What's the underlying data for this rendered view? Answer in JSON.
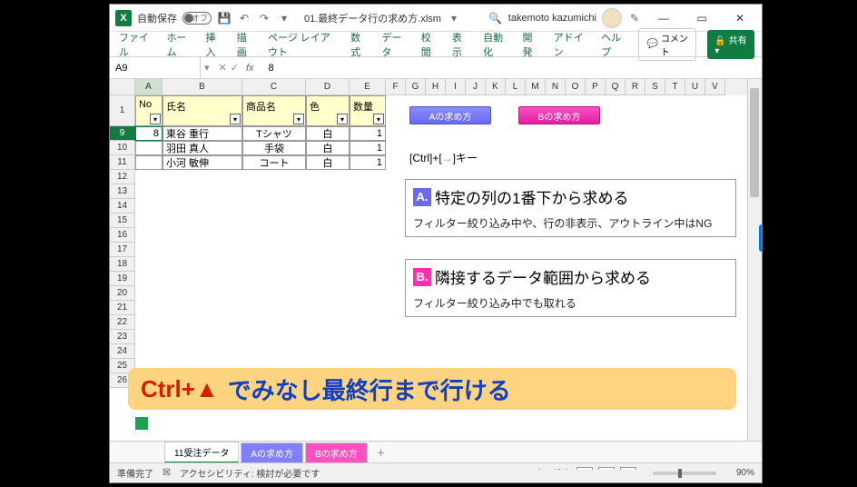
{
  "title": {
    "autosave_label": "自動保存",
    "filename": "01.最終データ行の求め方.xlsm",
    "username": "takemoto kazumichi"
  },
  "ribbon": {
    "tabs": [
      "ファイル",
      "ホーム",
      "挿入",
      "描画",
      "ページ レイアウト",
      "数式",
      "データ",
      "校閲",
      "表示",
      "自動化",
      "開発",
      "アドイン",
      "ヘルプ"
    ],
    "comment": "コメント",
    "share": "共有"
  },
  "formula": {
    "name": "A9",
    "value": "8"
  },
  "cols": [
    "A",
    "B",
    "C",
    "D",
    "E",
    "F",
    "G",
    "H",
    "I",
    "J",
    "K",
    "L",
    "M",
    "N",
    "O",
    "P",
    "Q",
    "R",
    "S",
    "T",
    "U",
    "V"
  ],
  "headers": {
    "no": "No",
    "name": "氏名",
    "item": "商品名",
    "color": "色",
    "qty": "数量"
  },
  "rows_visible": [
    "1",
    "9",
    "10",
    "11",
    "12",
    "13",
    "14",
    "15",
    "16",
    "17",
    "18",
    "19",
    "20",
    "21",
    "22",
    "23",
    "24",
    "25",
    "26"
  ],
  "data": [
    {
      "no": "8",
      "name": "東谷 重行",
      "item": "Tシャツ",
      "color": "白",
      "qty": "1"
    },
    {
      "no": "",
      "name": "羽田 真人",
      "item": "手袋",
      "color": "白",
      "qty": "1"
    },
    {
      "no": "",
      "name": "小河 敏伸",
      "item": "コート",
      "color": "白",
      "qty": "1"
    }
  ],
  "buttons": {
    "a": "Aの求め方",
    "b": "Bの求め方"
  },
  "hint": {
    "pre": "[Ctrl]+[",
    "arrow": "→",
    "post": "]キー"
  },
  "section_a": {
    "badge": "A.",
    "title": "特定の列の1番下から求める",
    "note": "フィルター絞り込み中や、行の非表示、アウトライン中はNG"
  },
  "section_b": {
    "badge": "B.",
    "title": "隣接するデータ範囲から求める",
    "note": "フィルター絞り込み中でも取れる"
  },
  "banner": {
    "red": "Ctrl+▲",
    "blue": " でみなし最終行まで行ける"
  },
  "sheets": {
    "active": "11受注データ",
    "a": "Aの求め方",
    "b": "Bの求め方"
  },
  "status": {
    "ready": "準備完了",
    "acc_icon": "☒",
    "acc": "アクセシビリティ: 検討が必要です",
    "disp": "表示設定",
    "zoom": "90%"
  },
  "chart_data": {
    "type": "table",
    "columns": [
      "No",
      "氏名",
      "商品名",
      "色",
      "数量"
    ],
    "rows": [
      [
        "8",
        "東谷 重行",
        "Tシャツ",
        "白",
        1
      ],
      [
        "",
        "羽田 真人",
        "手袋",
        "白",
        1
      ],
      [
        "",
        "小河 敏伸",
        "コート",
        "白",
        1
      ]
    ]
  }
}
